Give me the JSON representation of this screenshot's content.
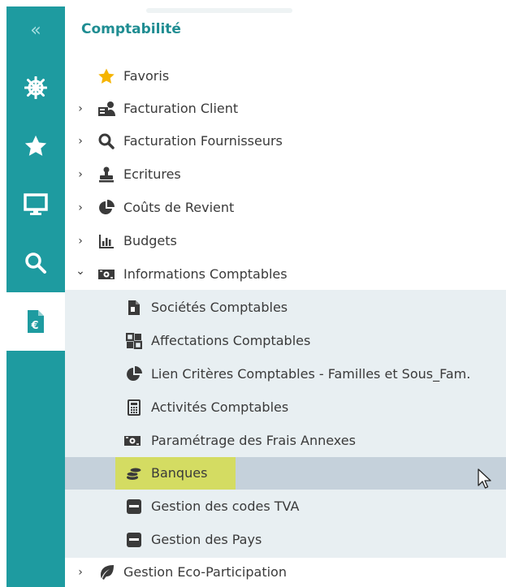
{
  "rail": {
    "collapse_glyph": "«",
    "icons": [
      "helm-icon",
      "star-icon",
      "monitor-icon",
      "search-icon",
      "invoice-euro-icon"
    ],
    "active": "invoice-euro-icon",
    "color": "#1e9ba0"
  },
  "panel": {
    "title": "Comptabilité",
    "title_color": "#1f8d92"
  },
  "menu": [
    {
      "label": "Favoris",
      "icon": "star-icon",
      "chevron": ""
    },
    {
      "label": "Facturation Client",
      "icon": "client-billing-icon",
      "chevron": "›"
    },
    {
      "label": "Facturation Fournisseurs",
      "icon": "search-icon",
      "chevron": "›"
    },
    {
      "label": "Ecritures",
      "icon": "stamp-icon",
      "chevron": "›"
    },
    {
      "label": "Coûts de Revient",
      "icon": "pie-chart-icon",
      "chevron": "›"
    },
    {
      "label": "Budgets",
      "icon": "bar-chart-icon",
      "chevron": "›"
    },
    {
      "label": "Informations Comptables",
      "icon": "money-icon",
      "chevron": "⌄"
    }
  ],
  "submenu": [
    {
      "label": "Sociétés Comptables",
      "icon": "document-icon"
    },
    {
      "label": "Affectations Comptables",
      "icon": "grid-icon"
    },
    {
      "label": "Lien Critères Comptables - Familles et Sous_Fam.",
      "icon": "pie-chart-icon"
    },
    {
      "label": "Activités Comptables",
      "icon": "calculator-icon"
    },
    {
      "label": "Paramétrage des Frais Annexes",
      "icon": "money-icon"
    },
    {
      "label": "Banques",
      "icon": "coins-icon",
      "selected": true
    },
    {
      "label": "Gestion des codes TVA",
      "icon": "tag-icon"
    },
    {
      "label": "Gestion des Pays",
      "icon": "tag-icon"
    }
  ],
  "footer_item": {
    "label": "Gestion Eco-Participation",
    "icon": "leaf-icon",
    "chevron": "›"
  },
  "colors": {
    "highlight": "#d4dc62",
    "selected_row": "#c5d1db",
    "submenu_bg": "#e8eff2",
    "star": "#f5b400"
  }
}
